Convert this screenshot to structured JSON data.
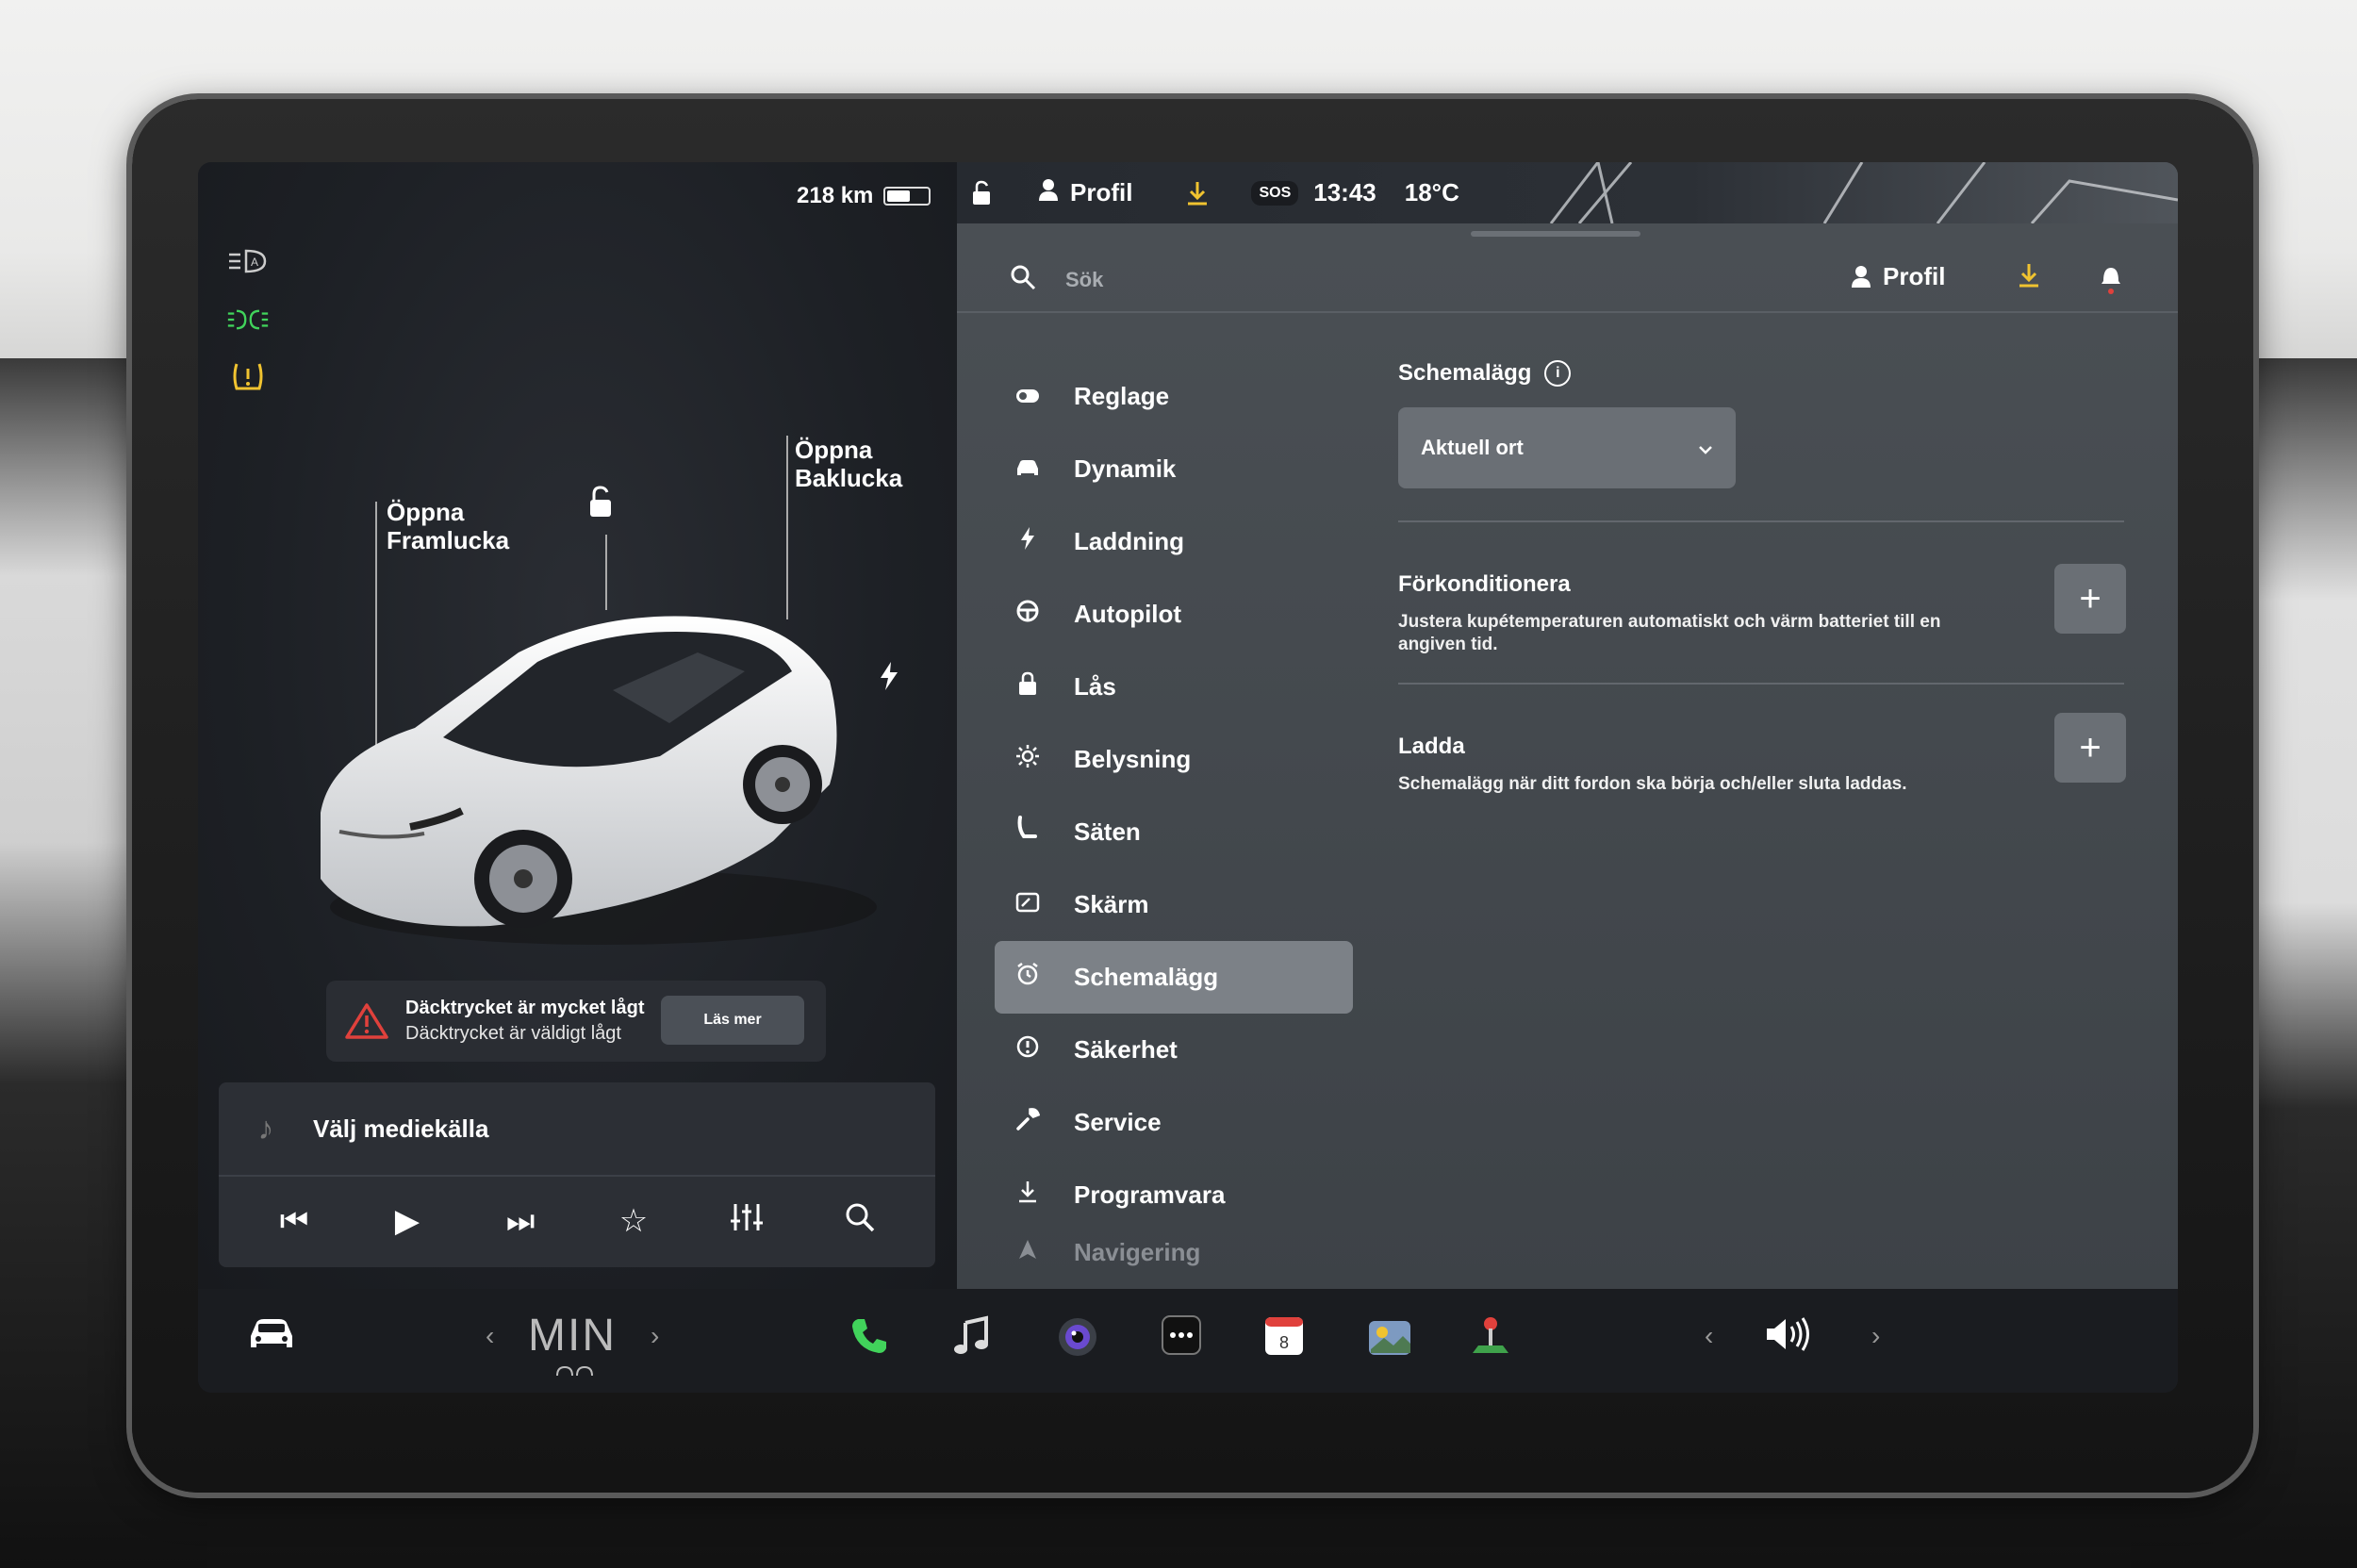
{
  "vehicle": {
    "range": "218 km",
    "battery_level": 0.55,
    "labels": {
      "front_trunk": "Öppna\nFramlucka",
      "rear_trunk": "Öppna\nBaklucka"
    },
    "left_icons": [
      "auto-headlights-icon",
      "parking-lights-icon",
      "tire-pressure-warning-icon"
    ],
    "status_icon_colors": {
      "parking_lights": "#41d35b",
      "tire_warning": "#f0c330"
    }
  },
  "alert": {
    "title": "Däcktrycket är mycket lågt",
    "subtitle": "Däcktrycket är väldigt lågt",
    "button": "Läs mer",
    "icon_color": "#e0413c"
  },
  "media": {
    "source_label": "Välj mediekälla",
    "controls": [
      "previous-icon",
      "play-icon",
      "next-icon",
      "favorite-icon",
      "equalizer-icon",
      "search-icon"
    ]
  },
  "statusbar": {
    "profile": "Profil",
    "sos": "SOS",
    "time": "13:43",
    "temperature": "18°C",
    "download_color": "#f0c330"
  },
  "search": {
    "placeholder": "Sök",
    "profile": "Profil",
    "bell_dot_color": "#e0413c"
  },
  "menu": [
    {
      "label": "Reglage",
      "icon": "toggle-icon"
    },
    {
      "label": "Dynamik",
      "icon": "car-icon"
    },
    {
      "label": "Laddning",
      "icon": "lightning-icon"
    },
    {
      "label": "Autopilot",
      "icon": "steering-wheel-icon"
    },
    {
      "label": "Lås",
      "icon": "lock-icon"
    },
    {
      "label": "Belysning",
      "icon": "sun-icon"
    },
    {
      "label": "Säten",
      "icon": "seat-icon"
    },
    {
      "label": "Skärm",
      "icon": "display-icon"
    },
    {
      "label": "Schemalägg",
      "icon": "alarm-clock-icon",
      "active": true
    },
    {
      "label": "Säkerhet",
      "icon": "alert-circle-icon"
    },
    {
      "label": "Service",
      "icon": "wrench-icon"
    },
    {
      "label": "Programvara",
      "icon": "download-icon"
    },
    {
      "label": "Navigering",
      "icon": "navigation-icon"
    }
  ],
  "schedule": {
    "title": "Schemalägg",
    "dropdown_value": "Aktuell ort",
    "precondition": {
      "title": "Förkonditionera",
      "description": "Justera kupétemperaturen automatiskt och värm batteriet till en angiven tid."
    },
    "charge": {
      "title": "Ladda",
      "description": "Schemalägg när ditt fordon ska börja och/eller sluta laddas."
    }
  },
  "dock": {
    "climate": "MIN",
    "calendar_day": "8",
    "phone_color": "#41d35b"
  }
}
